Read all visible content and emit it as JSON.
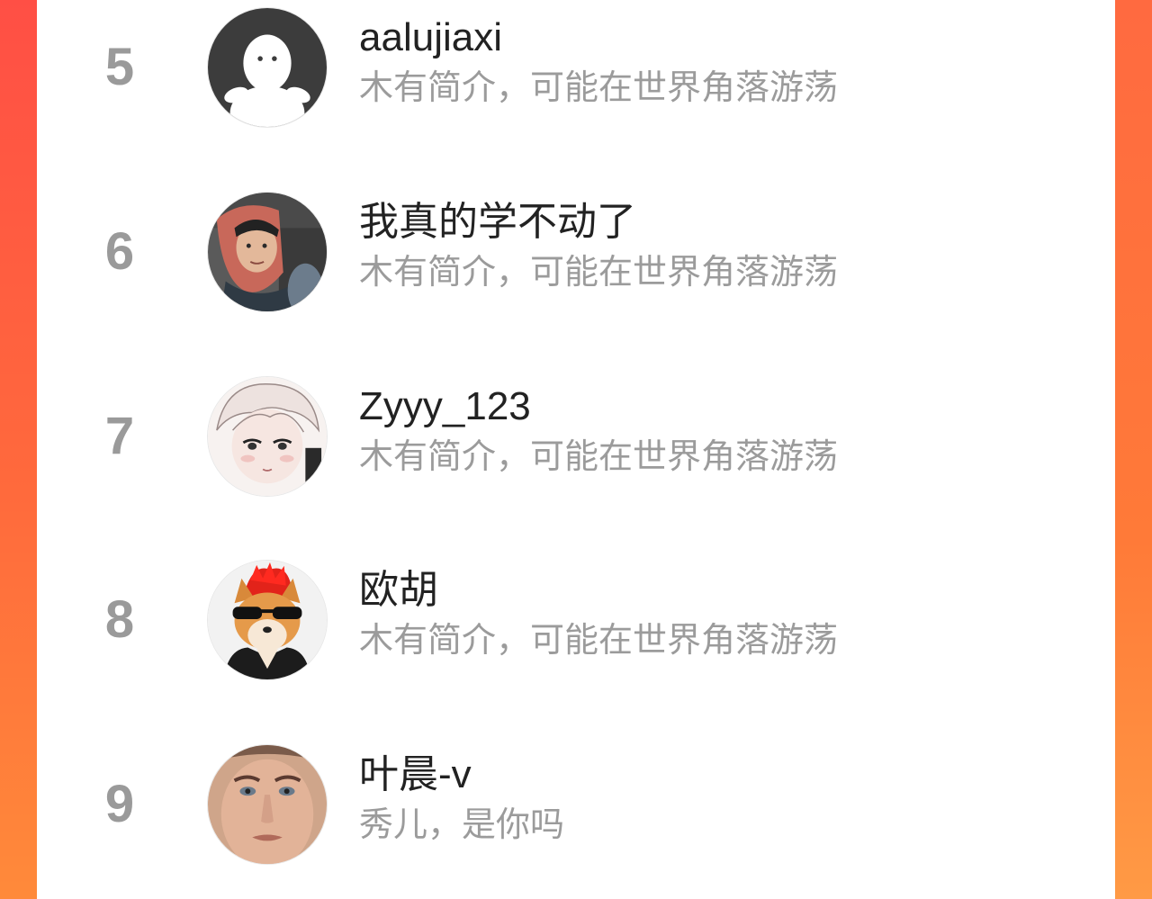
{
  "rank_list": {
    "items": [
      {
        "rank": "5",
        "name": "aalujiaxi",
        "bio": "木有简介，可能在世界角落游荡",
        "avatar": "default-ghost-avatar"
      },
      {
        "rank": "6",
        "name": "我真的学不动了",
        "bio": "木有简介，可能在世界角落游荡",
        "avatar": "photo-woman-headscarf-avatar"
      },
      {
        "rank": "7",
        "name": "Zyyy_123",
        "bio": "木有简介，可能在世界角落游荡",
        "avatar": "anime-character-avatar"
      },
      {
        "rank": "8",
        "name": "欧胡",
        "bio": "木有简介，可能在世界角落游荡",
        "avatar": "shiba-dog-sunglasses-avatar"
      },
      {
        "rank": "9",
        "name": "叶晨-v",
        "bio": "秀儿，是你吗",
        "avatar": "photo-man-face-avatar"
      }
    ]
  },
  "colors": {
    "background_red": "#ff4f45",
    "background_orange": "#ff8a3a",
    "rank_gray": "#9a9a9a",
    "name_text": "#222222",
    "bio_text": "#9b9b9b"
  }
}
